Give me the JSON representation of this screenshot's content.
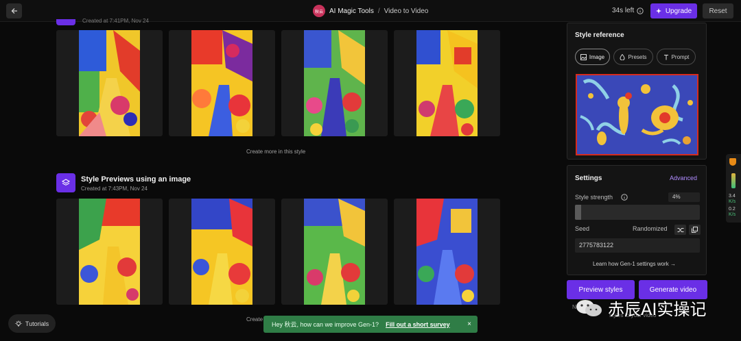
{
  "topbar": {
    "avatar_text": "秋云",
    "tool_name": "AI Magic Tools",
    "separator": "/",
    "page_name": "Video to Video",
    "time_left": "34s left",
    "upgrade_label": "Upgrade",
    "reset_label": "Reset"
  },
  "gallery": {
    "prev_section_caption": "Created at 7:41PM, Nov 24",
    "create_more_label": "Create more in this style",
    "section_title": "Style Previews using an image",
    "section_date": "Created at 7:43PM, Nov 24",
    "create_more_partial": "Create"
  },
  "style_reference": {
    "title": "Style reference",
    "tabs": [
      "Image",
      "Presets",
      "Prompt"
    ],
    "active_tab": "Image"
  },
  "settings": {
    "title": "Settings",
    "advanced_label": "Advanced",
    "strength_label": "Style strength",
    "strength_value": "4%",
    "strength_level": 0.05,
    "seed_label": "Seed",
    "randomized_label": "Randomized",
    "seed_value": "2775783122",
    "learn_link": "Learn how Gen-1 settings work"
  },
  "actions": {
    "preview_label": "Preview styles",
    "generate_label": "Generate video",
    "partial_left": "N",
    "partial_right": "styles to your video"
  },
  "side_widget": {
    "up_value": "3.4",
    "up_unit": "K/s",
    "down_value": "0.2",
    "down_unit": "K/s"
  },
  "tutorials_label": "Tutorials",
  "toast": {
    "message": "Hey 秋云, how can we improve Gen-1?",
    "link": "Fill out a short survey",
    "close": "×"
  },
  "watermark": "赤辰AI实操记",
  "colors": {
    "accent": "#6a2fe6",
    "toast": "#2f7d46",
    "link": "#b08cff"
  }
}
